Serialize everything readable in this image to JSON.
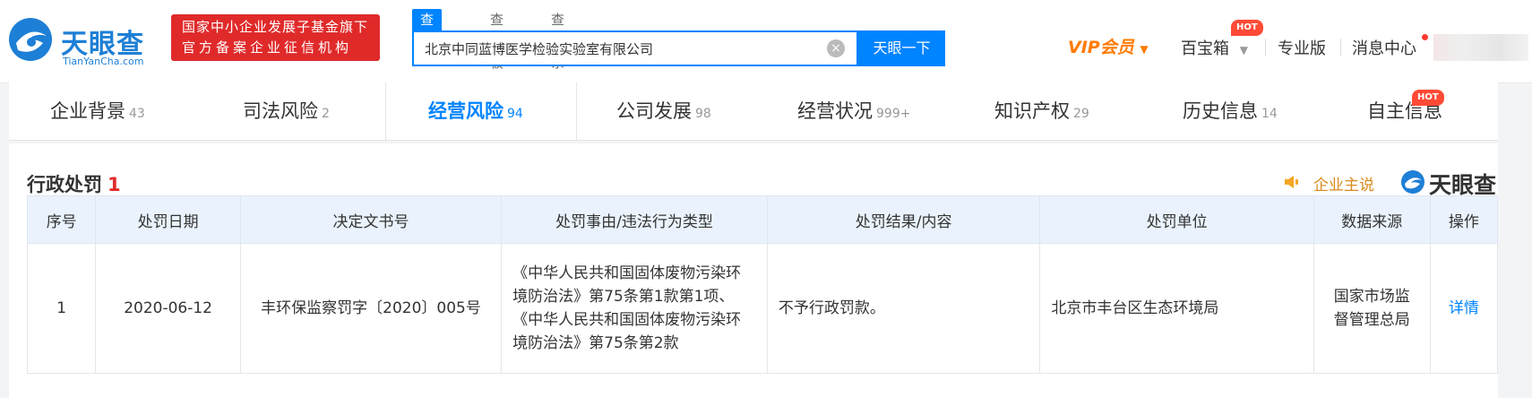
{
  "header": {
    "logo_cn": "天眼查",
    "logo_en": "TianYanCha.com",
    "badge_line1": "国家中小企业发展子基金旗下",
    "badge_line2": "官方备案企业征信机构",
    "search_tabs": [
      "查公司",
      "查老板",
      "查关系"
    ],
    "search_value": "北京中同蓝博医学检验实验室有限公司",
    "search_button": "天眼一下",
    "clear_glyph": "×",
    "vip": "VIP会员",
    "vip_caret": "▼",
    "nav": [
      "百宝箱",
      "专业版",
      "消息中心"
    ],
    "nav_caret": "▼",
    "hot": "HOT"
  },
  "tabs": [
    {
      "label": "企业背景",
      "count": "43"
    },
    {
      "label": "司法风险",
      "count": "2"
    },
    {
      "label": "经营风险",
      "count": "94"
    },
    {
      "label": "公司发展",
      "count": "98"
    },
    {
      "label": "经营状况",
      "count": "999+"
    },
    {
      "label": "知识产权",
      "count": "29"
    },
    {
      "label": "历史信息",
      "count": "14"
    },
    {
      "label": "自主信息",
      "count": ""
    }
  ],
  "section": {
    "title": "行政处罚",
    "count": "1",
    "claim": "企业主说",
    "brand": "天眼查"
  },
  "table": {
    "headers": [
      "序号",
      "处罚日期",
      "决定文书号",
      "处罚事由/违法行为类型",
      "处罚结果/内容",
      "处罚单位",
      "数据来源",
      "操作"
    ],
    "rows": [
      {
        "index": "1",
        "date": "2020-06-12",
        "doc_no": "丰环保监察罚字〔2020〕005号",
        "reason": "《中华人民共和国固体废物污染环境防治法》第75条第1款第1项、《中华人民共和国固体废物污染环境防治法》第75条第2款",
        "result": "不予行政罚款。",
        "unit": "北京市丰台区生态环境局",
        "source": "国家市场监督管理总局",
        "action": "详情"
      }
    ]
  },
  "colors": {
    "brand_blue": "#0084ff",
    "red": "#e02a2a",
    "vip_orange": "#ff7a00"
  }
}
